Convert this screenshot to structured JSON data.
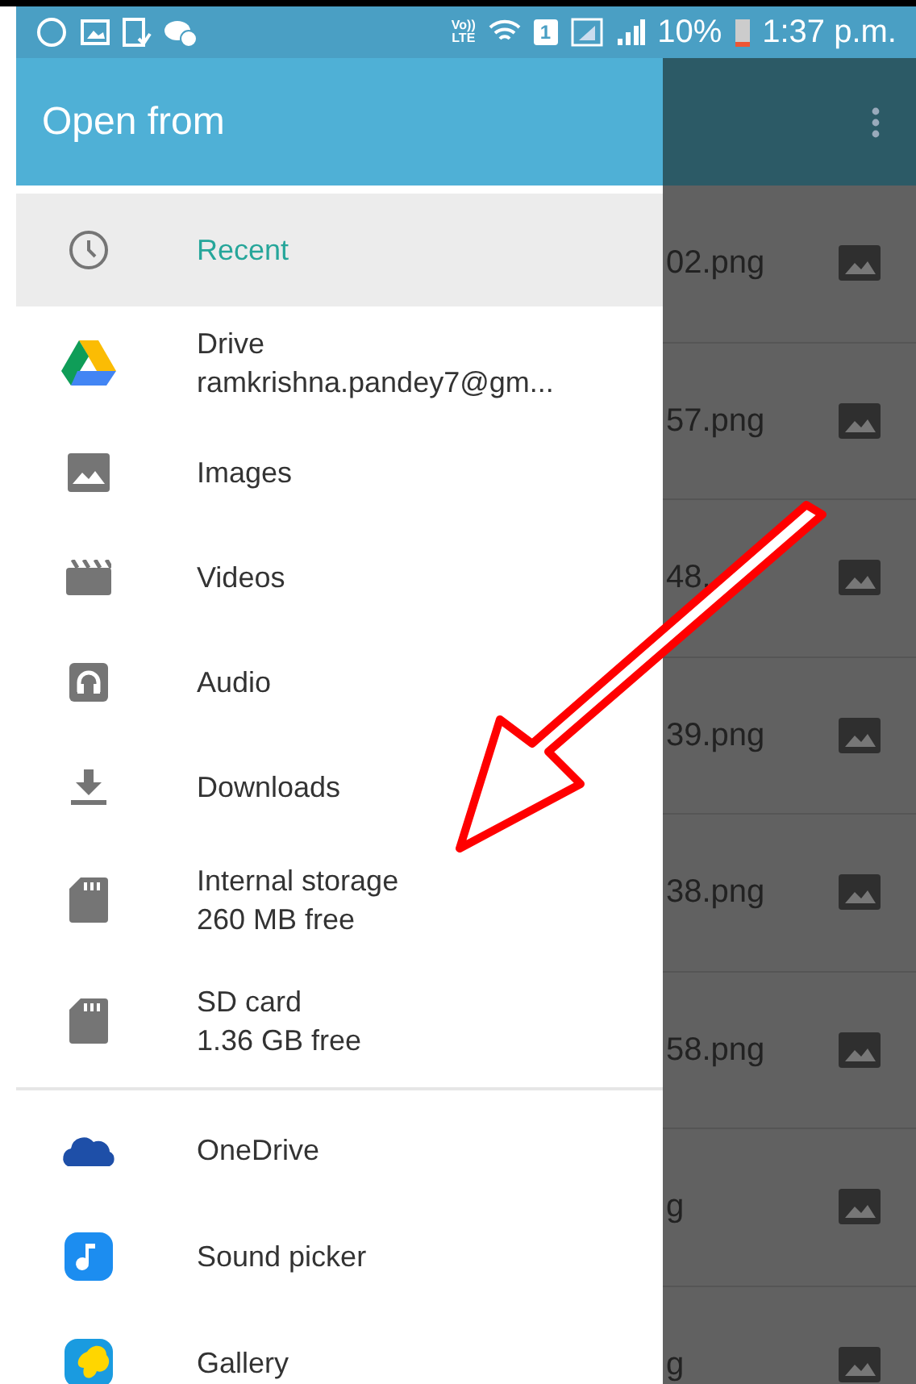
{
  "status_bar": {
    "lte": "Vo))\nLTE",
    "sim": "1",
    "battery": "10%",
    "time": "1:37 p.m."
  },
  "drawer": {
    "title": "Open from",
    "sections": [
      {
        "items": [
          {
            "label": "Recent",
            "selected": true
          },
          {
            "label": "Drive",
            "subtitle": "ramkrishna.pandey7@gm...",
            "selected": false
          },
          {
            "label": "Images",
            "selected": false
          },
          {
            "label": "Videos",
            "selected": false
          },
          {
            "label": "Audio",
            "selected": false
          },
          {
            "label": "Downloads",
            "selected": false
          },
          {
            "label": "Internal storage",
            "subtitle": "260 MB free",
            "selected": false
          },
          {
            "label": "SD card",
            "subtitle": "1.36 GB free",
            "selected": false
          }
        ]
      },
      {
        "items": [
          {
            "label": "OneDrive",
            "selected": false
          },
          {
            "label": "Sound picker",
            "selected": false
          },
          {
            "label": "Gallery",
            "selected": false
          }
        ]
      }
    ]
  },
  "files": [
    {
      "name": "02.png"
    },
    {
      "name": "57.png"
    },
    {
      "name": "48."
    },
    {
      "name": "39.png"
    },
    {
      "name": "38.png"
    },
    {
      "name": "58.png"
    },
    {
      "name": "g"
    },
    {
      "name": "g"
    }
  ]
}
